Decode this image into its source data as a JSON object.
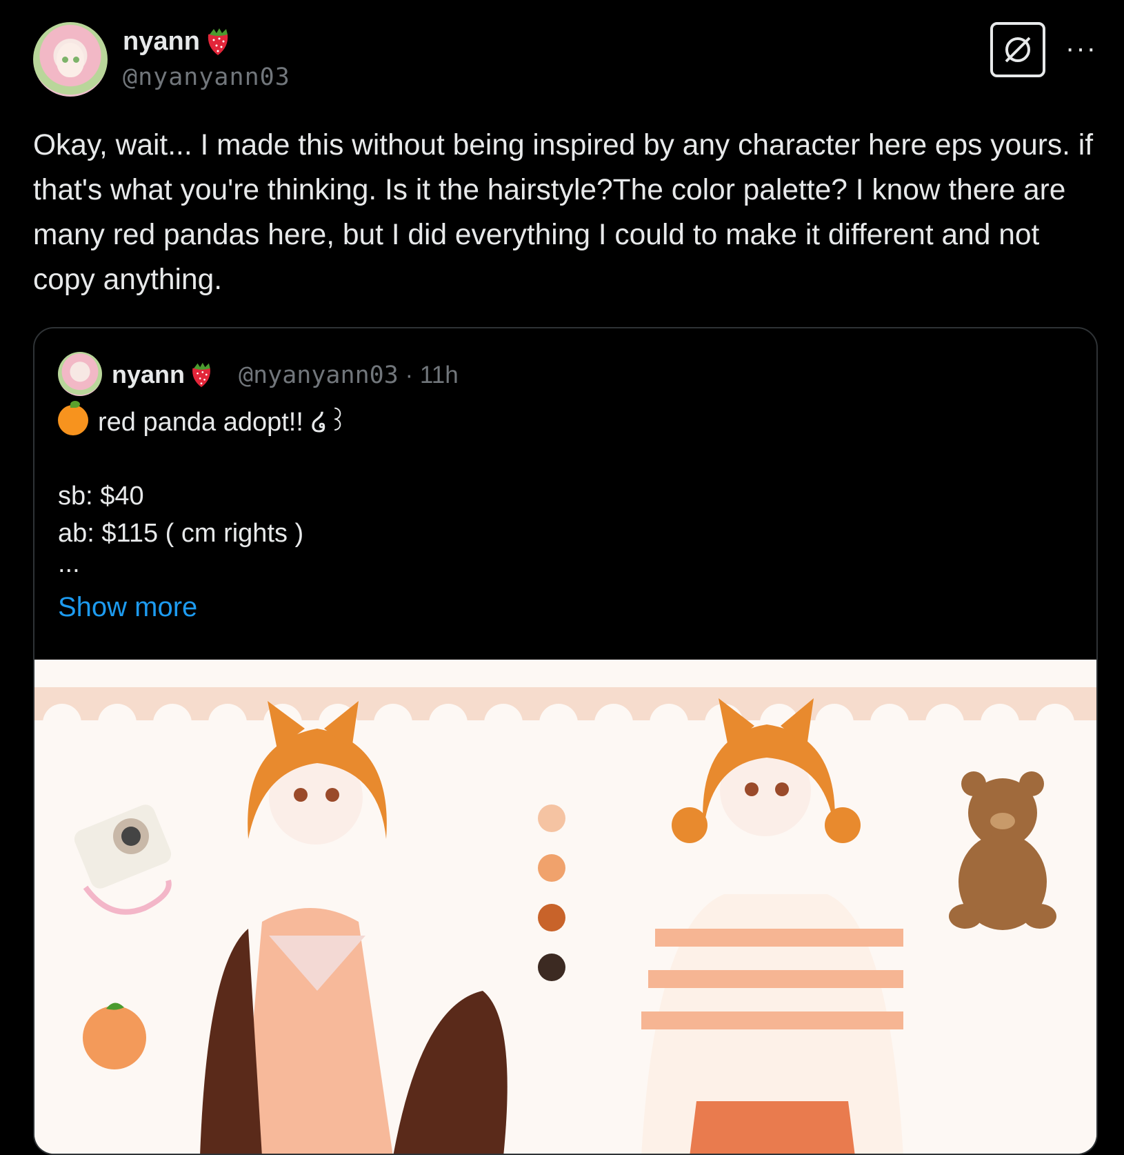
{
  "post": {
    "author_name": "nyann",
    "author_handle": "@nyanyann03",
    "text": "Okay, wait... I made this without being inspired by any character here eps yours. if that's what you're thinking. Is it the hairstyle?The color palette? I know there are many red pandas here, but I did everything I could to make it different and not copy anything."
  },
  "header": {
    "grok_icon": "grok-icon",
    "more_label": "···"
  },
  "quoted_post": {
    "author_name": "nyann",
    "author_handle": "@nyanyann03",
    "separator": "·",
    "time": "11h",
    "line1": "red panda adopt!! ໒꒱",
    "line2": "sb: $40",
    "line3": "ab: $115 ( cm rights )",
    "ellipsis": "...",
    "show_more": "Show more"
  },
  "colors": {
    "background": "#000000",
    "text": "#e7e9ea",
    "muted": "#71767b",
    "link": "#1d9bf0",
    "border": "#2f3336"
  }
}
